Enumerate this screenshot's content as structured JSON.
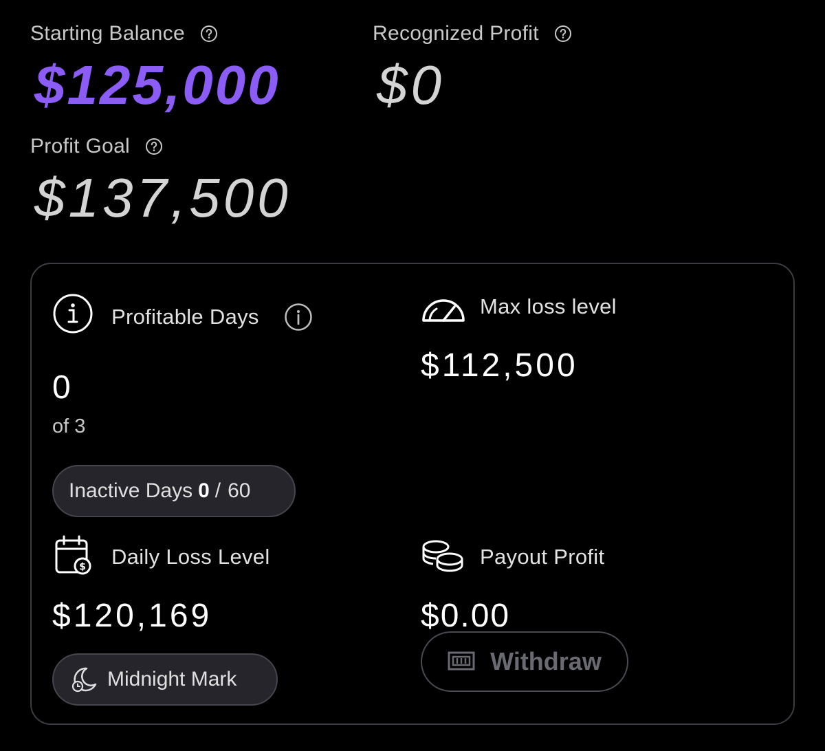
{
  "starting_balance": {
    "label": "Starting Balance",
    "value": "$125,000"
  },
  "recognized_profit": {
    "label": "Recognized Profit",
    "value": "$0"
  },
  "profit_goal": {
    "label": "Profit Goal",
    "value": "$137,500"
  },
  "profitable_days": {
    "label": "Profitable Days",
    "value": "0",
    "of_text": "of 3"
  },
  "inactive_days": {
    "label": "Inactive Days",
    "current": "0",
    "separator": "/",
    "max": "60"
  },
  "max_loss": {
    "label": "Max loss level",
    "value": "$112,500"
  },
  "daily_loss": {
    "label": "Daily Loss Level",
    "value": "$120,169",
    "midnight_label": "Midnight Mark"
  },
  "payout_profit": {
    "label": "Payout Profit",
    "value": "$0.00",
    "withdraw_label": "Withdraw"
  },
  "colors": {
    "accent": "#8b5cf6",
    "background": "#000000",
    "card_border": "#3c3c42"
  }
}
